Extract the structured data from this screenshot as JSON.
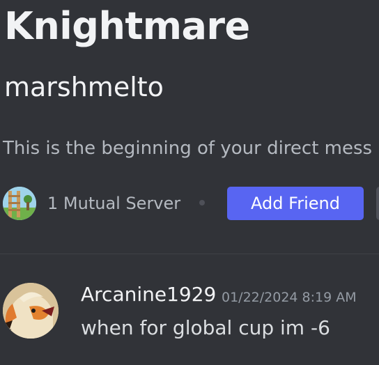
{
  "profile": {
    "display_name": "Knightmare",
    "username": "marshmelto",
    "beginning_text": "This is the beginning of your direct mess"
  },
  "mutual": {
    "servers_label": "1 Mutual Server",
    "server_icon": "server-icon"
  },
  "actions": {
    "add_friend_label": "Add Friend"
  },
  "message": {
    "author": "Arcanine1929",
    "timestamp": "01/22/2024 8:19 AM",
    "content": "when for global cup im -6",
    "avatar_icon": "arcanine-avatar"
  },
  "colors": {
    "background": "#313338",
    "accent": "#5865f2",
    "muted_text": "#b5bac1",
    "timestamp": "#949ba4"
  }
}
